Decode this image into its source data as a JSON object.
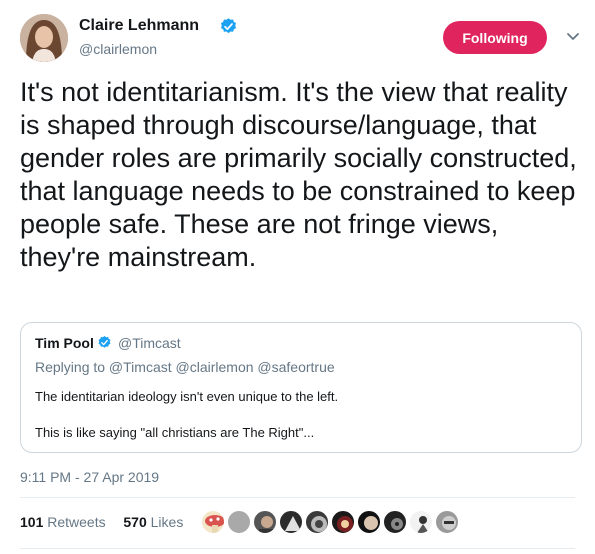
{
  "author": {
    "name": "Claire Lehmann",
    "handle": "@clairlemon",
    "follow_label": "Following"
  },
  "tweet": {
    "text": "It's not identitarianism. It's the view that reality is shaped through discourse/language, that gender roles are primarily socially constructed, that language needs to be constrained to keep people safe. These are not fringe views, they're mainstream.",
    "timestamp": "9:11 PM - 27 Apr 2019"
  },
  "quoted": {
    "name": "Tim Pool",
    "handle": "@Timcast",
    "replying_to": "Replying to @Timcast @clairlemon @safeortrue",
    "line1": "The identitarian ideology isn't even unique to the left.",
    "line2": "This is like saying \"all christians are The Right\"..."
  },
  "stats": {
    "retweets_count": "101",
    "retweets_label": "Retweets",
    "likes_count": "570",
    "likes_label": "Likes"
  },
  "colors": {
    "follow_button": "#e0245e",
    "verified_badge": "#1da1f2",
    "secondary_text": "#657786",
    "border": "#ccd6dd"
  },
  "icons": {
    "verified": "verified-badge-icon",
    "caret": "chevron-down-icon"
  }
}
